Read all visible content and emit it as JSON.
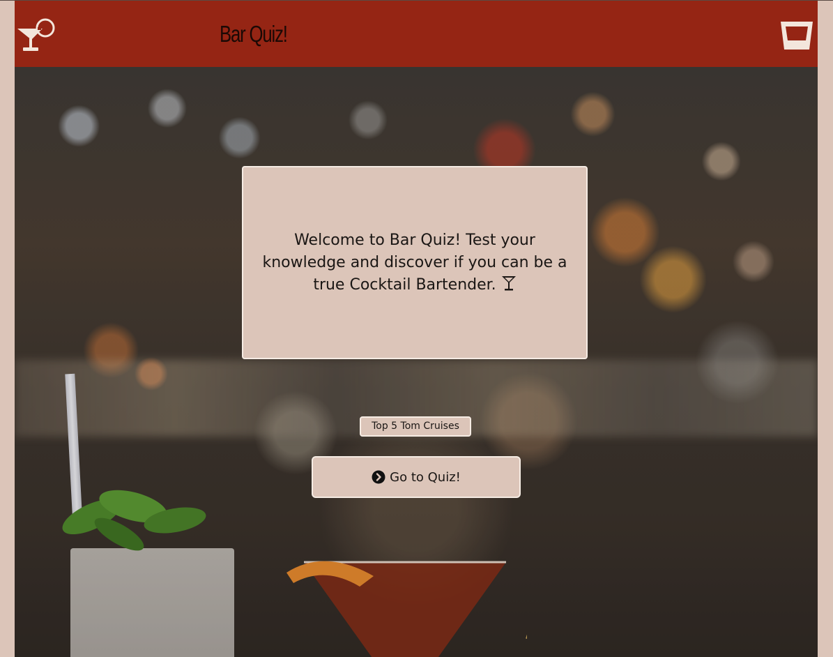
{
  "header": {
    "title": "Bar Quiz!",
    "logo_icon": "cocktail-glass-icon",
    "right_icon": "tumbler-glass-icon",
    "background_color": "#952514"
  },
  "welcome": {
    "text": "Welcome to Bar Quiz! Test your knowledge and discover if you can be a true Cocktail Bartender.",
    "trailing_icon": "martini-icon"
  },
  "category": {
    "label": "Top 5 Tom Cruises"
  },
  "actions": {
    "go_label": "Go to Quiz!",
    "go_icon": "chevron-circle-right-icon"
  },
  "colors": {
    "panel": "#dcc5b9",
    "panel_border": "#f6ece4",
    "accent": "#952514"
  }
}
